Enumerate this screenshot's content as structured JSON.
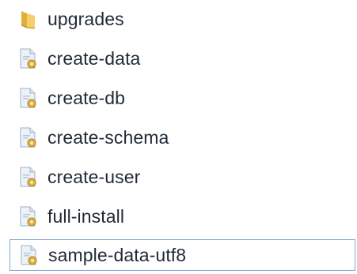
{
  "items": [
    {
      "label": "upgrades",
      "type": "folder",
      "icon": "folder-icon",
      "selected": false
    },
    {
      "label": "create-data",
      "type": "script",
      "icon": "script-file-icon",
      "selected": false
    },
    {
      "label": "create-db",
      "type": "script",
      "icon": "script-file-icon",
      "selected": false
    },
    {
      "label": "create-schema",
      "type": "script",
      "icon": "script-file-icon",
      "selected": false
    },
    {
      "label": "create-user",
      "type": "script",
      "icon": "script-file-icon",
      "selected": false
    },
    {
      "label": "full-install",
      "type": "script",
      "icon": "script-file-icon",
      "selected": false
    },
    {
      "label": "sample-data-utf8",
      "type": "script",
      "icon": "script-file-icon",
      "selected": true
    }
  ],
  "colors": {
    "selection_border": "#7fa7d6",
    "text": "#1f2a36",
    "folder": "#e8b84a",
    "script_page": "#dfe8f2",
    "script_gear": "#d9b24a"
  }
}
